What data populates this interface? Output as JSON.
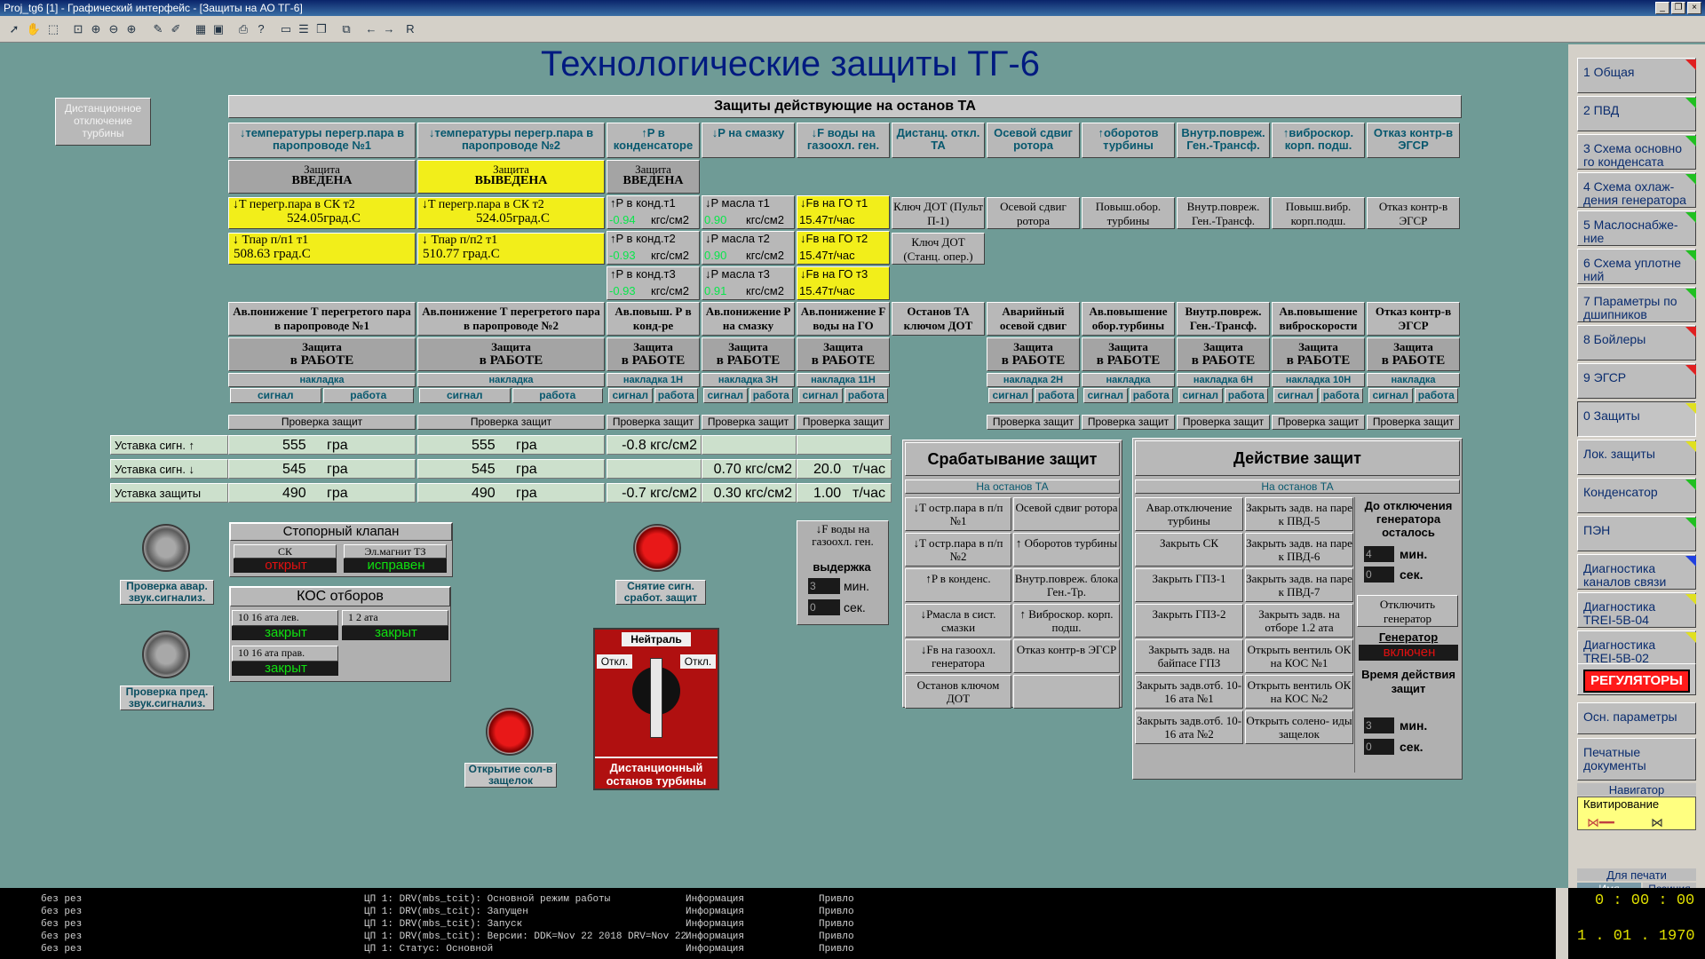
{
  "window": {
    "title": "Proj_tg6 [1] - Графический интерфейс - [Защиты на АО ТГ-6]"
  },
  "page_title": "Технологические защиты ТГ-6",
  "remote_off_btn": "Дистанционное отключение турбины",
  "main_header": "Защиты действующие на останов ТА",
  "columns": [
    {
      "head": "↓температуры перегр.пара в паропроводе №1",
      "status1": "Защита",
      "status2": "ВВЕДЕНА",
      "p1a": "↓T перегр.пара в СК т2",
      "p1b": "524.05град.С",
      "p2a": "↓        Тпар п/п1 т1",
      "p2b": "508.63  град.С",
      "mid": "Ав.понижение Т перегретого пара в паропроводе №1",
      "work1": "Защита",
      "work2": "в РАБОТЕ",
      "nak": "накладка",
      "sig": "сигнал",
      "rab": "работа",
      "check": "Проверка защит"
    },
    {
      "head": "↓температуры перегр.пара в паропроводе №2",
      "status1": "Защита",
      "status2": "ВЫВЕДЕНА",
      "p1a": "↓T перегр.пара в СК т2",
      "p1b": "524.05град.С",
      "p2a": "↓        Тпар п/п2 т1",
      "p2b": "510.77  град.С",
      "mid": "Ав.понижение Т перегретого пара в паропроводе №2",
      "work1": "Защита",
      "work2": "в РАБОТЕ",
      "nak": "накладка",
      "sig": "сигнал",
      "rab": "работа",
      "check": "Проверка защит"
    },
    {
      "head": "↑P в конденсаторе",
      "status1": "Защита",
      "status2": "ВВЕДЕНА",
      "r": [
        "↑P в конд.т1",
        "↑P в конд.т2",
        "↑P в конд.т3"
      ],
      "rv": [
        "-0.94",
        "-0.93",
        "-0.93"
      ],
      "ru": "кгс/см2",
      "mid": "Ав.повыш. Р в конд-ре",
      "work1": "Защита",
      "work2": "в РАБОТЕ",
      "nak": "накладка 1Н",
      "sig": "сигнал",
      "rab": "работа",
      "check": "Проверка защит"
    },
    {
      "head": "↓P на смазку",
      "r": [
        "↓P масла т1",
        "↓P масла т2",
        "↓P масла т3"
      ],
      "rv": [
        "0.90",
        "0.90",
        "0.91"
      ],
      "ru": "кгс/см2",
      "mid": "Ав.понижение Р на смазку",
      "work1": "Защита",
      "work2": "в РАБОТЕ",
      "nak": "накладка 3Н",
      "sig": "сигнал",
      "rab": "работа",
      "check": "Проверка защит"
    },
    {
      "head": "↓F воды на газоохл. ген.",
      "r": [
        "↓Fв на ГО т1",
        "↓Fв на ГО т2",
        "↓Fв на ГО т3"
      ],
      "rv": [
        "15.47т/час",
        "15.47т/час",
        "15.47т/час"
      ],
      "mid": "Ав.понижение F воды на ГО",
      "work1": "Защита",
      "work2": "в РАБОТЕ",
      "nak": "накладка 11Н",
      "sig": "сигнал",
      "rab": "работа",
      "check": "Проверка защит"
    },
    {
      "head": "Дистанц. откл. ТА",
      "k1": "Ключ ДОТ (Пульт П-1)",
      "k2": "Ключ ДОТ (Станц. опер.)",
      "mid": "Останов ТА ключом ДОТ"
    },
    {
      "head": "Осевой сдвиг ротора",
      "k1": "Осевой сдвиг ротора",
      "mid": "Аварийный осевой сдвиг",
      "work1": "Защита",
      "work2": "в РАБОТЕ",
      "nak": "накладка 2Н",
      "sig": "сигнал",
      "rab": "работа",
      "check": "Проверка защит"
    },
    {
      "head": "↑оборотов турбины",
      "k1": "Повыш.обор. турбины",
      "mid": "Ав.повышение обор.турбины",
      "work1": "Защита",
      "work2": "в РАБОТЕ",
      "nak": "накладка",
      "sig": "сигнал",
      "rab": "работа",
      "check": "Проверка защит"
    },
    {
      "head": "Внутр.повреж. Ген.-Трансф.",
      "k1": "Внутр.повреж. Ген.-Трансф.",
      "mid": "Внутр.повреж. Ген.-Трансф.",
      "work1": "Защита",
      "work2": "в РАБОТЕ",
      "nak": "накладка 6Н",
      "sig": "сигнал",
      "rab": "работа",
      "check": "Проверка защит"
    },
    {
      "head": "↑виброскор. корп. подш.",
      "k1": "Повыш.вибр. корп.подш.",
      "mid": "Ав.повышение виброскорости",
      "work1": "Защита",
      "work2": "в РАБОТЕ",
      "nak": "накладка 10Н",
      "sig": "сигнал",
      "rab": "работа",
      "check": "Проверка защит"
    },
    {
      "head": "Отказ контр-в ЭГСР",
      "k1": "Отказ контр-в ЭГСР",
      "mid": "Отказ контр-в ЭГСР",
      "work1": "Защита",
      "work2": "в РАБОТЕ",
      "nak": "накладка",
      "sig": "сигнал",
      "rab": "работа",
      "check": "Проверка защит"
    }
  ],
  "setpoints": {
    "labels": [
      "Уставка сигн. ↑",
      "Уставка сигн. ↓",
      "Уставка защиты"
    ],
    "c1": [
      [
        "555",
        "гра"
      ],
      [
        "545",
        "гра"
      ],
      [
        "490",
        "гра"
      ]
    ],
    "c2": [
      [
        "555",
        "гра"
      ],
      [
        "545",
        "гра"
      ],
      [
        "490",
        "гра"
      ]
    ],
    "c3": [
      "-0.8  кгс/см2",
      "",
      "-0.7  кгс/см2"
    ],
    "c4": [
      "",
      "0.70  кгс/см2",
      "0.30  кгс/см2"
    ],
    "c5": [
      [
        "",
        ""
      ],
      [
        "20.0",
        "т/час"
      ],
      [
        "1.00",
        "т/час"
      ]
    ]
  },
  "stop_valve": {
    "title": "Стопорный клапан",
    "sk": "СК",
    "sk_state": "открыт",
    "mag": "Эл.магнит ТЗ",
    "mag_state": "исправен"
  },
  "kos": {
    "title": "КОС отборов",
    "a": "10 16 ата лев.",
    "a_s": "закрыт",
    "b": "1 2 ата",
    "b_s": "закрыт",
    "c": "10 16 ата прав.",
    "c_s": "закрыт"
  },
  "btn_check_alarm": "Проверка авар. звук.сигнализ.",
  "btn_check_warn": "Проверка пред. звук.сигнализ.",
  "btn_reset": "Снятие сигн. сработ. защит",
  "btn_open_sol": "Открытие сол-в защелок",
  "water_delay": {
    "head": "↓F воды на газоохл. ген.",
    "sub": "выдержка",
    "m": "3",
    "mu": "мин.",
    "s": "0",
    "su": "сек."
  },
  "remote_stop": {
    "neutral": "Нейтраль",
    "off1": "Откл.",
    "off2": "Откл.",
    "label": "Дистанционный останов турбины"
  },
  "trip": {
    "title": "Срабатывание защит",
    "sub": "На останов ТА",
    "items": [
      "↓T остр.пара в п/п №1",
      "Осевой сдвиг ротора",
      "↓T остр.пара в п/п №2",
      "↑  Оборотов турбины",
      "↑P в конденс.",
      "Внутр.повреж. блока Ген.-Тр.",
      "↓Рмасла в сист. смазки",
      "↑  Виброскор. корп. подш.",
      "↓Fв на газоохл. генератора",
      "Отказ контр-в ЭГСР",
      "Останов ключом ДОТ",
      ""
    ]
  },
  "action": {
    "title": "Действие защит",
    "sub": "На останов ТА",
    "left": [
      "Авар.отключение турбины",
      "Закрыть СК",
      "Закрыть ГПЗ-1",
      "Закрыть ГПЗ-2",
      "Закрыть задв. на байпасе ГПЗ",
      "Закрыть задв.отб. 10-16 ата №1",
      "Закрыть задв.отб. 10-16 ата №2"
    ],
    "mid": [
      "Закрыть задв. на паре к ПВД-5",
      "Закрыть задв. на паре к ПВД-6",
      "Закрыть задв. на паре к ПВД-7",
      "Закрыть задв. на отборе 1.2 ата",
      "Открыть вентиль ОК на КОС №1",
      "Открыть вентиль ОК на КОС №2",
      "Открыть солено- иды защелок"
    ],
    "till": "До отключения генератора осталось",
    "tm": "4",
    "tmu": "мин.",
    "ts": "0",
    "tsu": "сек.",
    "off_gen": "Отключить генератор",
    "gen": "Генератор",
    "gen_state": "включен",
    "time_act": "Время действия защит",
    "am": "3",
    "amu": "мин.",
    "as": "0",
    "asu": "сек."
  },
  "sidebar": [
    {
      "label": "1 Общая",
      "c": "#e02020"
    },
    {
      "label": "2 ПВД",
      "c": "#20c020"
    },
    {
      "label": "3 Схема основно го конденсата",
      "c": "#20c020"
    },
    {
      "label": "4 Схема охлаж- дения генератора",
      "c": "#20c020"
    },
    {
      "label": "5 Маслоснабже- ние",
      "c": "#20c020"
    },
    {
      "label": "6 Схема уплотне ний",
      "c": "#20c020"
    },
    {
      "label": "7 Параметры по дшипников",
      "c": "#20c020"
    },
    {
      "label": "8 Бойлеры",
      "c": "#e02020"
    },
    {
      "label": "9 ЭГСР",
      "c": "#e02020"
    },
    {
      "label": "0 Защиты",
      "c": "#e0e020"
    },
    {
      "label": "Лок. защиты",
      "c": "#e0e020"
    },
    {
      "label": "Конденсатор",
      "c": "#20c020"
    },
    {
      "label": "ПЭН",
      "c": "#20c020"
    },
    {
      "label": "Диагностика каналов связи",
      "c": "#2040e0"
    },
    {
      "label": "Диагностика TREI-5B-04",
      "c": "#e0e020"
    },
    {
      "label": "Диагностика TREI-5B-02",
      "c": "#e0e020"
    }
  ],
  "reg_btn": "РЕГУЛЯТОРЫ",
  "osn": "Осн. параметры",
  "print_docs": "Печатные документы",
  "navigator": "Навигатор",
  "kvit": "Квитирование",
  "for_print": "Для печати",
  "name": "Имя",
  "pos": "Позиция",
  "log": [
    [
      "без рез",
      "ЦП 1: DRV(mbs_tcit): Основной режим работы",
      "Информация",
      "Привло"
    ],
    [
      "без рез",
      "ЦП 1: DRV(mbs_tcit): Запущен",
      "Информация",
      "Привло"
    ],
    [
      "без рез",
      "ЦП 1: DRV(mbs_tcit): Запуск",
      "Информация",
      "Привло"
    ],
    [
      "без рез",
      "ЦП 1: DRV(mbs_tcit): Версии: DDK=Nov 22 2018 DRV=Nov 22",
      "Информация",
      "Привло"
    ],
    [
      "без рез",
      "ЦП 1: Статус: Основной",
      "Информация",
      "Привло"
    ]
  ],
  "clock": "0 : 00 : 00",
  "date": "1  . 01 . 1970"
}
